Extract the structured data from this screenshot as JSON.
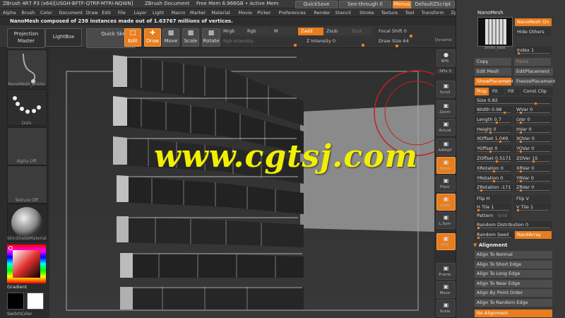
{
  "titlebar": {
    "app": "ZBrush 4R7 P3 (x64)[USGH-BFTF-QTRP-MTRI-NQWN]",
    "doc": "ZBrush Document",
    "mem": "Free Mem 6.966GB • Active Mem",
    "quicksave": "QuickSave",
    "seethrough": "See-through  0",
    "menus": "Menus",
    "zscript": "DefaultZScript"
  },
  "menubar": {
    "items": [
      "Alpha",
      "Brush",
      "Color",
      "Document",
      "Draw",
      "Edit",
      "File",
      "Layer",
      "Light",
      "Macro",
      "Marker",
      "Material",
      "Movie",
      "Picker",
      "Preferences",
      "Render",
      "Stencil",
      "Stroke",
      "Texture",
      "Tool",
      "Transform",
      "Zplugin",
      "Zscript"
    ]
  },
  "infobar": {
    "text": "NanoMesh composed of 238 instances made out of 1.63767 millions of vertices."
  },
  "toolbar": {
    "projection_master": "Projection Master",
    "lightbox": "LightBox",
    "quick_sketch": "Quick Sketch",
    "edit": "Edit",
    "draw": "Draw",
    "move": "Move",
    "scale": "Scale",
    "rotate": "Rotate",
    "mrgb": "Mrgb",
    "rgb": "Rgb",
    "m": "M",
    "zadd": "Zadd",
    "zsub": "Zsub",
    "zcut": "Zcut",
    "rgb_intensity": "Rgb Intensity",
    "z_intensity": "Z Intensity 0",
    "focal_shift": "Focal Shift 0",
    "draw_size": "Draw Size 64",
    "dynamic": "Dynamic"
  },
  "leftpanel": {
    "brush_label": "NanoMesh_Bricks",
    "stroke_label": "Dots",
    "alpha_label": "Alpha Off",
    "texture_label": "Texture Off",
    "material_label": "SkinShadeMaterial",
    "gradient_label": "Gradient",
    "switch_label": "SwitchColor"
  },
  "viewport": {
    "watermark": "www.cgtsj.com"
  },
  "shelf": {
    "items": [
      {
        "label": "BPR",
        "icon": "bpr-sphere-icon"
      },
      {
        "label": "SPix 3",
        "icon": ""
      },
      {
        "label": "Scroll",
        "icon": "scroll-icon"
      },
      {
        "label": "Zoom",
        "icon": "zoom-icon"
      },
      {
        "label": "Actual",
        "icon": "actual-icon"
      },
      {
        "label": "AAHalf",
        "icon": "aahalf-icon"
      },
      {
        "label": "Persp",
        "icon": "persp-icon"
      },
      {
        "label": "Floor",
        "icon": "floor-icon"
      },
      {
        "label": "Local",
        "icon": "local-icon"
      },
      {
        "label": "L.Sym",
        "icon": "lsym-icon"
      },
      {
        "label": "XYZ",
        "icon": "xyz-icon"
      },
      {
        "label": "Frame",
        "icon": "frame-icon"
      },
      {
        "label": "Move",
        "icon": "move-icon"
      },
      {
        "label": "Scale",
        "icon": "scale-icon"
      }
    ]
  },
  "rightpanel": {
    "title": "NanoMesh",
    "nanomesh_on": "NanoMesh On",
    "hide_others": "Hide Others",
    "thumb_label": "bricks_base",
    "index": "Index 1",
    "copy": "Copy",
    "paste": "Paste",
    "edit_mesh": "Edit Mesh",
    "edit_placement": "EditPlacement",
    "show_placement": "ShowPlacement",
    "freeze_placement": "FreezePlacement",
    "prop": "Prop",
    "fit": "Fit",
    "fill": "Fill",
    "const_clip": "Const Clip",
    "size": "Size 0.82",
    "sliders": [
      {
        "left": "Width 0.98",
        "right": "WVar 0",
        "lk": 0.85,
        "rk": 0.1
      },
      {
        "left": "Length 0.7",
        "right": "LVar 0",
        "lk": 0.6,
        "rk": 0.1
      },
      {
        "left": "Height 0",
        "right": "HVar 0",
        "lk": 0.4,
        "rk": 0.1
      },
      {
        "left": "XOffset 1.049",
        "right": "XOVar 0",
        "lk": 0.7,
        "rk": 0.1
      },
      {
        "left": "YOffset 0",
        "right": "YOVar 0",
        "lk": 0.4,
        "rk": 0.1
      },
      {
        "left": "ZOffset 0.5171",
        "right": "ZOVar 15",
        "lk": 0.6,
        "rk": 0.5
      },
      {
        "left": "XRotation 0",
        "right": "XRVar 0",
        "lk": 0.5,
        "rk": 0.1
      },
      {
        "left": "YRotation 0",
        "right": "YRVar 0",
        "lk": 0.5,
        "rk": 0.1
      },
      {
        "left": "ZRotation -171",
        "right": "ZRVar 0",
        "lk": 0.1,
        "rk": 0.1
      }
    ],
    "flip_h": "Flip H",
    "flip_v": "Flip V",
    "h_tile": "H Tile 1",
    "v_tile": "V Tile 1",
    "pattern": "Pattern",
    "grid": "Grid",
    "random_distribution": "Random Distribution 0",
    "random_seed": "Random Seed",
    "rand_array": "RandArray",
    "alignment": "Alignment",
    "align_items": [
      "Align To Normal",
      "Align To Short Edge",
      "Align To Long Edge",
      "Align To Near Edge",
      "Align By Point Order",
      "Align To Random Edge"
    ],
    "no_alignment": "No Alignment"
  },
  "colors": {
    "accent": "#e87d1e",
    "watermark": "#f0f000"
  }
}
